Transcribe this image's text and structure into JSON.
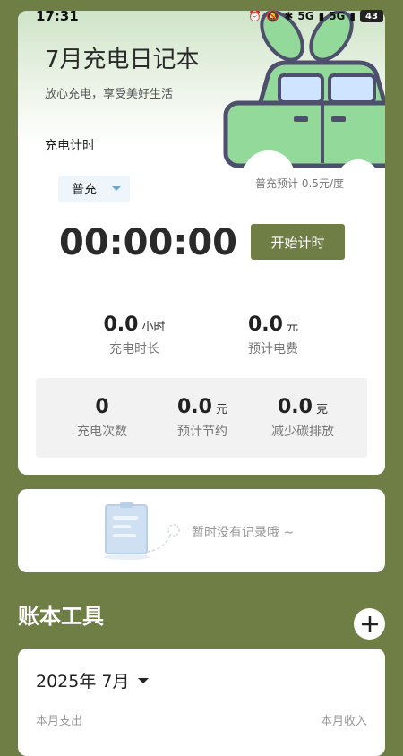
{
  "status_bar": {
    "time": "17:31",
    "signal1": "5G",
    "signal2": "5G",
    "battery": "43",
    "icons": [
      "alarm-icon",
      "mute-icon",
      "bluetooth-icon",
      "signal-icon",
      "battery-icon"
    ]
  },
  "header": {
    "title": "7月充电日记本",
    "subtitle": "放心充电，享受美好生活"
  },
  "timer_section": {
    "label": "充电计时",
    "mode": "普充",
    "price_note": "普充预计 0.5元/度",
    "time": "00:00:00",
    "start_button": "开始计时"
  },
  "stats": {
    "duration": {
      "value": "0.0",
      "unit": "小时",
      "label": "充电时长"
    },
    "cost": {
      "value": "0.0",
      "unit": "元",
      "label": "预计电费"
    },
    "count": {
      "value": "0",
      "unit": "",
      "label": "充电次数"
    },
    "saving": {
      "value": "0.0",
      "unit": "元",
      "label": "预计节约"
    },
    "carbon": {
      "value": "0.0",
      "unit": "克",
      "label": "减少碳排放"
    }
  },
  "records": {
    "empty_text": "暂时没有记录哦 ~"
  },
  "tools": {
    "title": "账本工具",
    "month": "2025年 7月",
    "left_label": "本月支出",
    "right_label": "本月收入"
  },
  "colors": {
    "background": "#6f7e45",
    "accent": "#6f7e45",
    "car_body": "#92d99a",
    "car_outline": "#4d4f6c"
  }
}
